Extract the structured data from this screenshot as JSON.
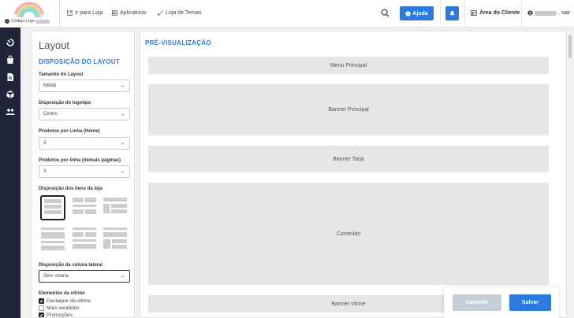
{
  "header": {
    "store_code_label": "Código Loja",
    "nav": [
      {
        "label": "Ir para Loja",
        "icon": "external-link-icon"
      },
      {
        "label": "Aplicativos",
        "icon": "apps-icon"
      },
      {
        "label": "Loja de Temas",
        "icon": "brush-icon"
      }
    ],
    "help_label": "Ajuda",
    "client_area_label": "Área do Cliente",
    "logout_label": ", sair"
  },
  "rail": {
    "icons": [
      "dashboard-icon",
      "bag-icon",
      "document-icon",
      "box-icon",
      "users-icon"
    ]
  },
  "panel": {
    "title": "Layout",
    "section": "DISPOSIÇÃO DO LAYOUT",
    "fields": [
      {
        "label": "Tamanho do Layout",
        "value": "Médio"
      },
      {
        "label": "Disposição do logotipo",
        "value": "Centro"
      },
      {
        "label": "Produtos por Linha (Home)",
        "value": "3"
      },
      {
        "label": "Produtos por linha (demais páginas)",
        "value": "3"
      }
    ],
    "items_layout_label": "Disposição dos itens da loja",
    "sidebar_label": "Disposição da coluna lateral",
    "sidebar_value": "Sem coluna",
    "showcase_label": "Elementos da vitrine",
    "checkboxes": [
      {
        "label": "Destaque da vitrine",
        "checked": true
      },
      {
        "label": "Mais vendidos",
        "checked": false
      },
      {
        "label": "Promoções",
        "checked": true
      }
    ]
  },
  "preview": {
    "title": "PRÉ-VISUALIZAÇÃO",
    "blocks": [
      "Menu Principal",
      "Banner Principal",
      "Banner Tarja",
      "Conteúdo",
      "Banner vitrine"
    ]
  },
  "footer": {
    "cancel_label": "Cancelar",
    "save_label": "Salvar"
  },
  "colors": {
    "accent": "#2b7bdf",
    "rail": "#1f2438"
  }
}
